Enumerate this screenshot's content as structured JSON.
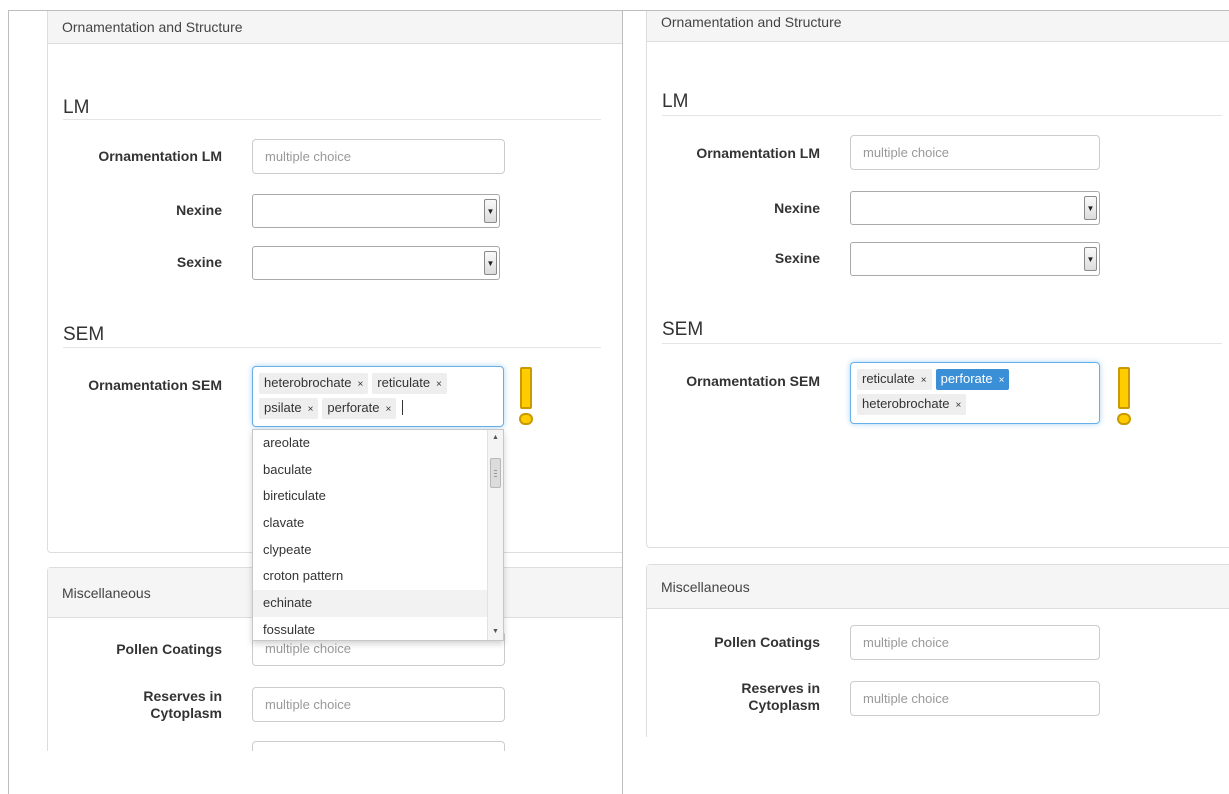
{
  "left": {
    "ornamentation_panel": {
      "heading": "Ornamentation and Structure",
      "lm": {
        "title": "LM",
        "ornamentation_label": "Ornamentation LM",
        "ornamentation_placeholder": "multiple choice",
        "nexine_label": "Nexine",
        "sexine_label": "Sexine"
      },
      "sem": {
        "title": "SEM",
        "ornamentation_label": "Ornamentation SEM",
        "chips": [
          "heterobrochate",
          "reticulate",
          "psilate",
          "perforate"
        ]
      }
    },
    "dropdown": {
      "options": [
        "areolate",
        "baculate",
        "bireticulate",
        "clavate",
        "clypeate",
        "croton pattern",
        "echinate",
        "fossulate"
      ],
      "highlighted": "echinate"
    },
    "misc_panel": {
      "heading": "Miscellaneous",
      "pollen_coatings_label": "Pollen Coatings",
      "pollen_coatings_placeholder": "multiple choice",
      "reserves_label_1": "Reserves in",
      "reserves_label_2": "Cytoplasm",
      "reserves_placeholder": "multiple choice"
    }
  },
  "right": {
    "ornamentation_panel": {
      "heading": "Ornamentation and Structure",
      "lm": {
        "title": "LM",
        "ornamentation_label": "Ornamentation LM",
        "ornamentation_placeholder": "multiple choice",
        "nexine_label": "Nexine",
        "sexine_label": "Sexine"
      },
      "sem": {
        "title": "SEM",
        "ornamentation_label": "Ornamentation SEM",
        "chips": [
          "reticulate",
          "perforate",
          "heterobrochate"
        ],
        "active_chip": "perforate"
      }
    },
    "misc_panel": {
      "heading": "Miscellaneous",
      "pollen_coatings_label": "Pollen Coatings",
      "pollen_coatings_placeholder": "multiple choice",
      "reserves_label_1": "Reserves in",
      "reserves_label_2": "Cytoplasm",
      "reserves_placeholder": "multiple choice"
    }
  },
  "colors": {
    "warning": "#ffcc00",
    "focus": "#66afe9",
    "active_chip": "#3b8fd6"
  },
  "chip_remove_glyph": "×",
  "select_arrow_glyph": "▼",
  "scroll_up_glyph": "▲",
  "scroll_down_glyph": "▼"
}
